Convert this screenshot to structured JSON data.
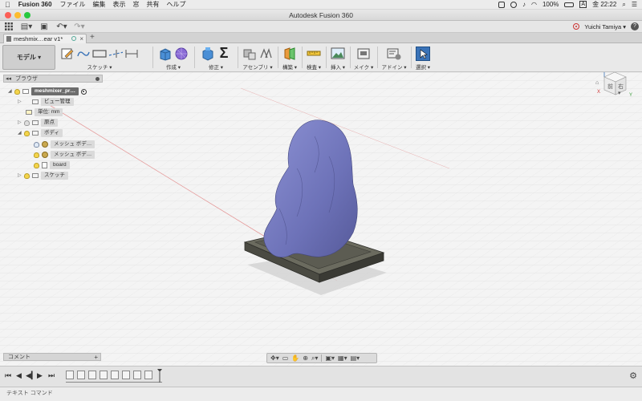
{
  "menubar": {
    "app_name": "Fusion 360",
    "items": [
      "ファイル",
      "編集",
      "表示",
      "窓",
      "共有",
      "ヘルプ"
    ],
    "battery": "100%",
    "input_source": "A",
    "clock": "金 22:22"
  },
  "window": {
    "title": "Autodesk Fusion 360"
  },
  "quick_access": {
    "user_name": "Yuichi Tamiya ▾",
    "help_label": "?"
  },
  "document_tab": {
    "label": "meshmix…ear v1*",
    "close": "×",
    "add": "+"
  },
  "toolbar": {
    "workspace": "モデル ▾",
    "groups": [
      "スケッチ ▾",
      "作成 ▾",
      "修正 ▾",
      "アセンブリ ▾",
      "構築 ▾",
      "検査 ▾",
      "挿入 ▾",
      "メイク ▾",
      "アドイン ▾",
      "選択 ▾"
    ]
  },
  "browser": {
    "title": "ブラウザ",
    "root": "meshmixer_pr…",
    "nodes": {
      "view_manager": "ビュー管理",
      "units": "単位: mm",
      "origin": "原点",
      "bodies": "ボディ",
      "mesh_body_1": "メッシュ ボデ…",
      "mesh_body_2": "メッシュ ボデ…",
      "board": "board",
      "sketch": "スケッチ"
    }
  },
  "viewcube": {
    "front": "前",
    "right": "右",
    "axis_z": "Z",
    "axis_x": "X",
    "axis_y": "Y"
  },
  "comments": {
    "title": "コメント",
    "add": "+"
  },
  "text_command": {
    "label": "テキスト コマンド"
  },
  "colors": {
    "accent_blue": "#3a73b8",
    "mesh_purple": "#7b7fc3",
    "board_dark": "#4a4a42"
  }
}
